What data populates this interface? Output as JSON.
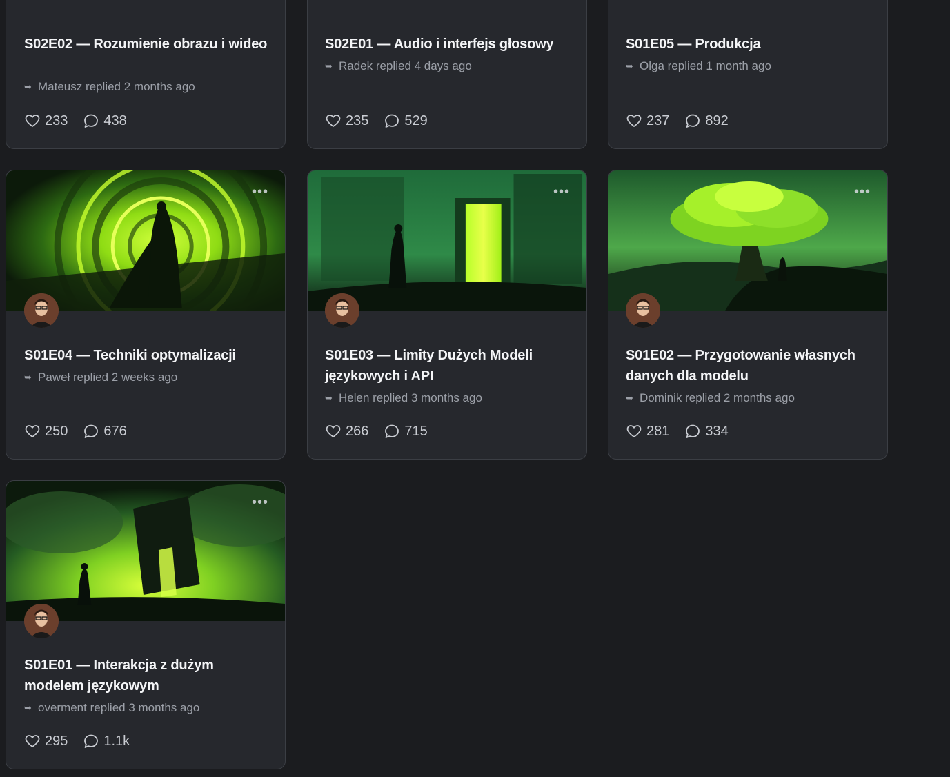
{
  "cards": [
    {
      "title": "S02E02 — Rozumienie obrazu i wideo",
      "reply": "Mateusz replied 2 months ago",
      "likes": "233",
      "comments": "438"
    },
    {
      "title": "S02E01 — Audio i interfejs głosowy",
      "reply": "Radek replied 4 days ago",
      "likes": "235",
      "comments": "529"
    },
    {
      "title": "S01E05 — Produkcja",
      "reply": "Olga replied 1 month ago",
      "likes": "237",
      "comments": "892"
    },
    {
      "title": "S01E04 — Techniki optymalizacji",
      "reply": "Paweł replied 2 weeks ago",
      "likes": "250",
      "comments": "676",
      "image": "portal-rings-figure"
    },
    {
      "title": "S01E03 — Limity Dużych Modeli językowych i API",
      "reply": "Helen replied 3 months ago",
      "likes": "266",
      "comments": "715",
      "image": "glowing-gate-figure"
    },
    {
      "title": "S01E02 — Przygotowanie własnych danych dla modelu",
      "reply": "Dominik replied 2 months ago",
      "likes": "281",
      "comments": "334",
      "image": "tree-of-light-figure"
    },
    {
      "title": "S01E01 — Interakcja z dużym modelem językowym",
      "reply": "overment replied 3 months ago",
      "likes": "295",
      "comments": "1.1k",
      "image": "monolith-figure"
    }
  ],
  "icons": {
    "reply": "reply-arrow-icon",
    "like": "heart-icon",
    "comment": "comment-bubble-icon",
    "menu": "more-dots-icon"
  },
  "more_glyph": "•••",
  "reply_glyph": "➥",
  "colors": {
    "background": "#1b1c1f",
    "card": "#26282d",
    "border": "#3b3e44",
    "accent_green": "#a4ef1e",
    "text": "#f4f5f7",
    "muted": "#9ca0a8"
  }
}
